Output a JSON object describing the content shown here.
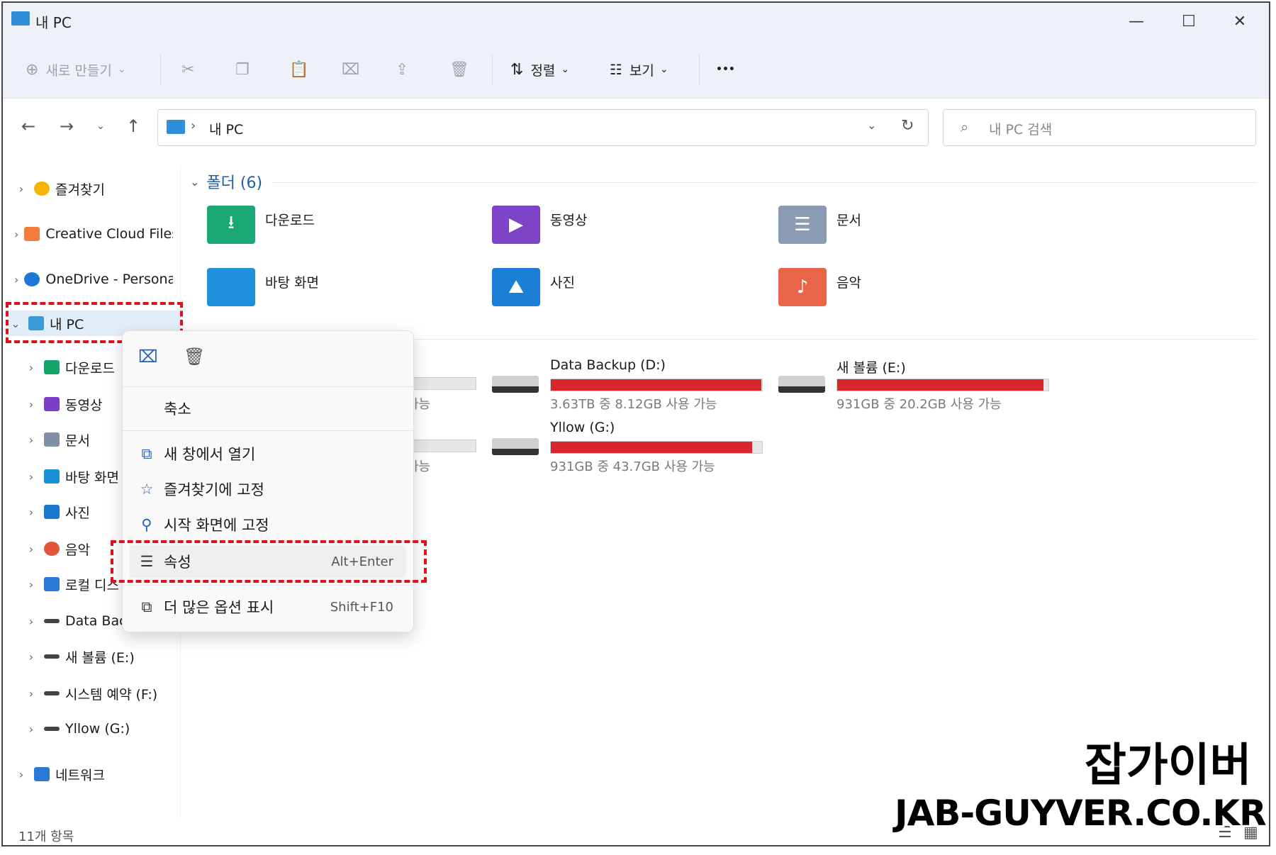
{
  "window": {
    "title": "내 PC"
  },
  "toolbar": {
    "new_label": "새로 만들기",
    "sort_label": "정렬",
    "view_label": "보기",
    "more_label": "•••"
  },
  "address": {
    "path": "내 PC",
    "search_placeholder": "내 PC 검색"
  },
  "sidebar": {
    "items": [
      {
        "label": "즐겨찾기",
        "icon": "star-icon",
        "color": "#f5b400"
      },
      {
        "label": "Creative Cloud Files",
        "icon": "creative-cloud-icon",
        "color": "#f27c3b"
      },
      {
        "label": "OneDrive - Persona",
        "icon": "onedrive-cloud-icon",
        "color": "#1e78d7"
      },
      {
        "label": "내 PC",
        "icon": "monitor-icon",
        "color": "#3a9ad9"
      },
      {
        "label": "다운로드",
        "icon": "download-icon",
        "color": "#14a36b"
      },
      {
        "label": "동영상",
        "icon": "video-icon",
        "color": "#7a3fc4"
      },
      {
        "label": "문서",
        "icon": "document-icon",
        "color": "#7f8fa4"
      },
      {
        "label": "바탕 화면",
        "icon": "desktop-icon",
        "color": "#1a8fd8"
      },
      {
        "label": "사진",
        "icon": "picture-icon",
        "color": "#1b78d0"
      },
      {
        "label": "음악",
        "icon": "music-icon",
        "color": "#e2553a"
      },
      {
        "label": "로컬 디스",
        "icon": "windows-drive-icon",
        "color": "#2b79d6"
      },
      {
        "label": "Data Bac",
        "icon": "drive-icon",
        "color": "#444444"
      },
      {
        "label": "새 볼륨 (E:)",
        "icon": "drive-icon",
        "color": "#444444"
      },
      {
        "label": "시스템 예약 (F:)",
        "icon": "drive-icon",
        "color": "#444444"
      },
      {
        "label": "Yllow (G:)",
        "icon": "drive-icon",
        "color": "#444444"
      },
      {
        "label": "네트워크",
        "icon": "network-icon",
        "color": "#2b79d6"
      }
    ]
  },
  "folders": {
    "header": "폴더 (6)",
    "items": [
      {
        "label": "다운로드",
        "color": "#1aa874"
      },
      {
        "label": "동영상",
        "color": "#7d44c8"
      },
      {
        "label": "문서",
        "color": "#8a9bb3"
      },
      {
        "label": "바탕 화면",
        "color": "#1e90dc"
      },
      {
        "label": "사진",
        "color": "#1c7fd6"
      },
      {
        "label": "음악",
        "color": "#e8654a"
      }
    ]
  },
  "drives": {
    "items": [
      {
        "name": "Data Backup (D:)",
        "space": "3.63TB 중 8.12GB 사용 가능",
        "used_fraction": 0.998
      },
      {
        "name": "새 볼륨 (E:)",
        "space": "931GB 중 20.2GB 사용 가능",
        "used_fraction": 0.978
      },
      {
        "name": "Yllow (G:)",
        "space": "931GB 중 43.7GB 사용 가능",
        "used_fraction": 0.953
      }
    ],
    "partial_space": [
      "가능",
      "가능"
    ]
  },
  "context_menu": {
    "collapse": "축소",
    "open_new_window": "새 창에서 열기",
    "pin_quick_access": "즐겨찾기에 고정",
    "pin_start": "시작 화면에 고정",
    "properties": "속성",
    "properties_shortcut": "Alt+Enter",
    "more_options": "더 많은 옵션 표시",
    "more_options_shortcut": "Shift+F10"
  },
  "status": {
    "count": "11개 항목"
  },
  "watermark": {
    "line1": "잡가이버",
    "line2": "JAB-GUYVER.CO.KR"
  }
}
